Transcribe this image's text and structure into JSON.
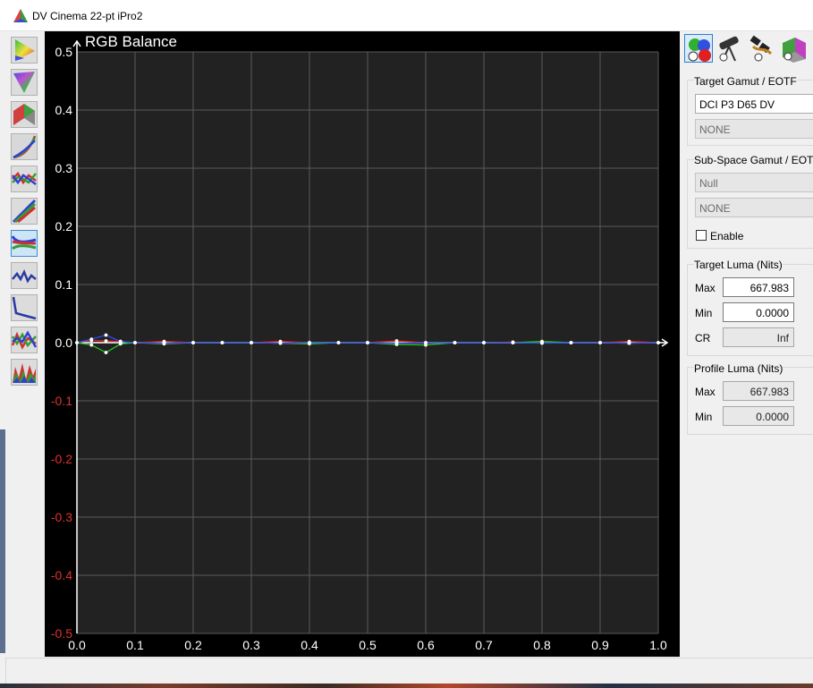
{
  "window": {
    "title": "DV Cinema 22-pt iPro2"
  },
  "left_toolbar": {
    "tools": [
      {
        "icon": "gamut-triangle-icon",
        "active": false
      },
      {
        "icon": "gamut-triangle-inverted-icon",
        "active": false
      },
      {
        "icon": "gamut-3d-icon",
        "active": false
      },
      {
        "icon": "eotf-curves-icon",
        "active": false
      },
      {
        "icon": "rgb-lines-icon",
        "active": false
      },
      {
        "icon": "grayscale-tracking-icon",
        "active": false
      },
      {
        "icon": "rgb-balance-icon",
        "active": true
      },
      {
        "icon": "deltae-line-icon",
        "active": false
      },
      {
        "icon": "luminance-decay-icon",
        "active": false
      },
      {
        "icon": "rgb-error-icon",
        "active": false
      },
      {
        "icon": "rgb-spikes-icon",
        "active": false
      }
    ]
  },
  "chart_data": {
    "type": "line",
    "title": "RGB Balance",
    "xlim": [
      0.0,
      1.0
    ],
    "ylim": [
      -0.5,
      0.5
    ],
    "x_ticks": [
      "0.0",
      "0.1",
      "0.2",
      "0.3",
      "0.4",
      "0.5",
      "0.6",
      "0.7",
      "0.8",
      "0.9",
      "1.0"
    ],
    "y_ticks": [
      "0.5",
      "0.4",
      "0.3",
      "0.2",
      "0.1",
      "0.0",
      "-0.1",
      "-0.2",
      "-0.3",
      "-0.4",
      "-0.5"
    ],
    "grid": true,
    "x": [
      0.0,
      0.025,
      0.05,
      0.075,
      0.1,
      0.15,
      0.2,
      0.25,
      0.3,
      0.35,
      0.4,
      0.45,
      0.5,
      0.55,
      0.6,
      0.65,
      0.7,
      0.75,
      0.8,
      0.85,
      0.9,
      0.95,
      1.0
    ],
    "series": [
      {
        "color": "#e02020",
        "values": [
          0.0,
          0.004,
          0.003,
          0.002,
          0.0,
          0.002,
          0.0,
          0.0,
          0.0,
          0.002,
          0.0,
          0.0,
          0.0,
          0.003,
          0.0,
          0.0,
          0.0,
          0.001,
          0.0,
          0.0,
          0.0,
          0.002,
          0.0
        ]
      },
      {
        "color": "#22cc22",
        "values": [
          0.0,
          -0.004,
          -0.017,
          -0.002,
          0.0,
          -0.002,
          0.0,
          0.0,
          0.0,
          -0.001,
          -0.002,
          0.0,
          0.0,
          -0.003,
          -0.004,
          0.0,
          0.0,
          0.0,
          0.002,
          0.0,
          0.0,
          -0.001,
          0.0
        ]
      },
      {
        "color": "#2a4cff",
        "values": [
          0.0,
          0.006,
          0.013,
          0.002,
          0.0,
          -0.001,
          0.0,
          0.0,
          0.0,
          -0.001,
          0.0,
          0.0,
          0.0,
          -0.001,
          0.0,
          0.0,
          0.0,
          0.0,
          -0.001,
          0.0,
          0.0,
          -0.001,
          0.0
        ]
      }
    ],
    "negative_tick_color": "#e03030"
  },
  "right_panel": {
    "top_icons": [
      {
        "icon": "rgb-dots-icon",
        "active": true
      },
      {
        "icon": "telescope-icon",
        "active": false
      },
      {
        "icon": "cables-icon",
        "active": false
      },
      {
        "icon": "cube-icon",
        "active": false
      }
    ],
    "target_gamut": {
      "label": "Target Gamut / EOTF",
      "gamut_value": "DCI P3 D65 DV",
      "eotf_value": "NONE"
    },
    "sub_space": {
      "label": "Sub-Space  Gamut / EOTF",
      "gamut_value": "Null",
      "eotf_value": "NONE",
      "enable_label": "Enable"
    },
    "target_luma": {
      "label": "Target Luma (Nits)",
      "max_label": "Max",
      "max_value": "667.983",
      "min_label": "Min",
      "min_value": "0.0000",
      "cr_label": "CR",
      "cr_value": "Inf"
    },
    "profile_luma": {
      "label": "Profile Luma (Nits)",
      "max_label": "Max",
      "max_value": "667.983",
      "min_label": "Min",
      "min_value": "0.0000"
    }
  }
}
